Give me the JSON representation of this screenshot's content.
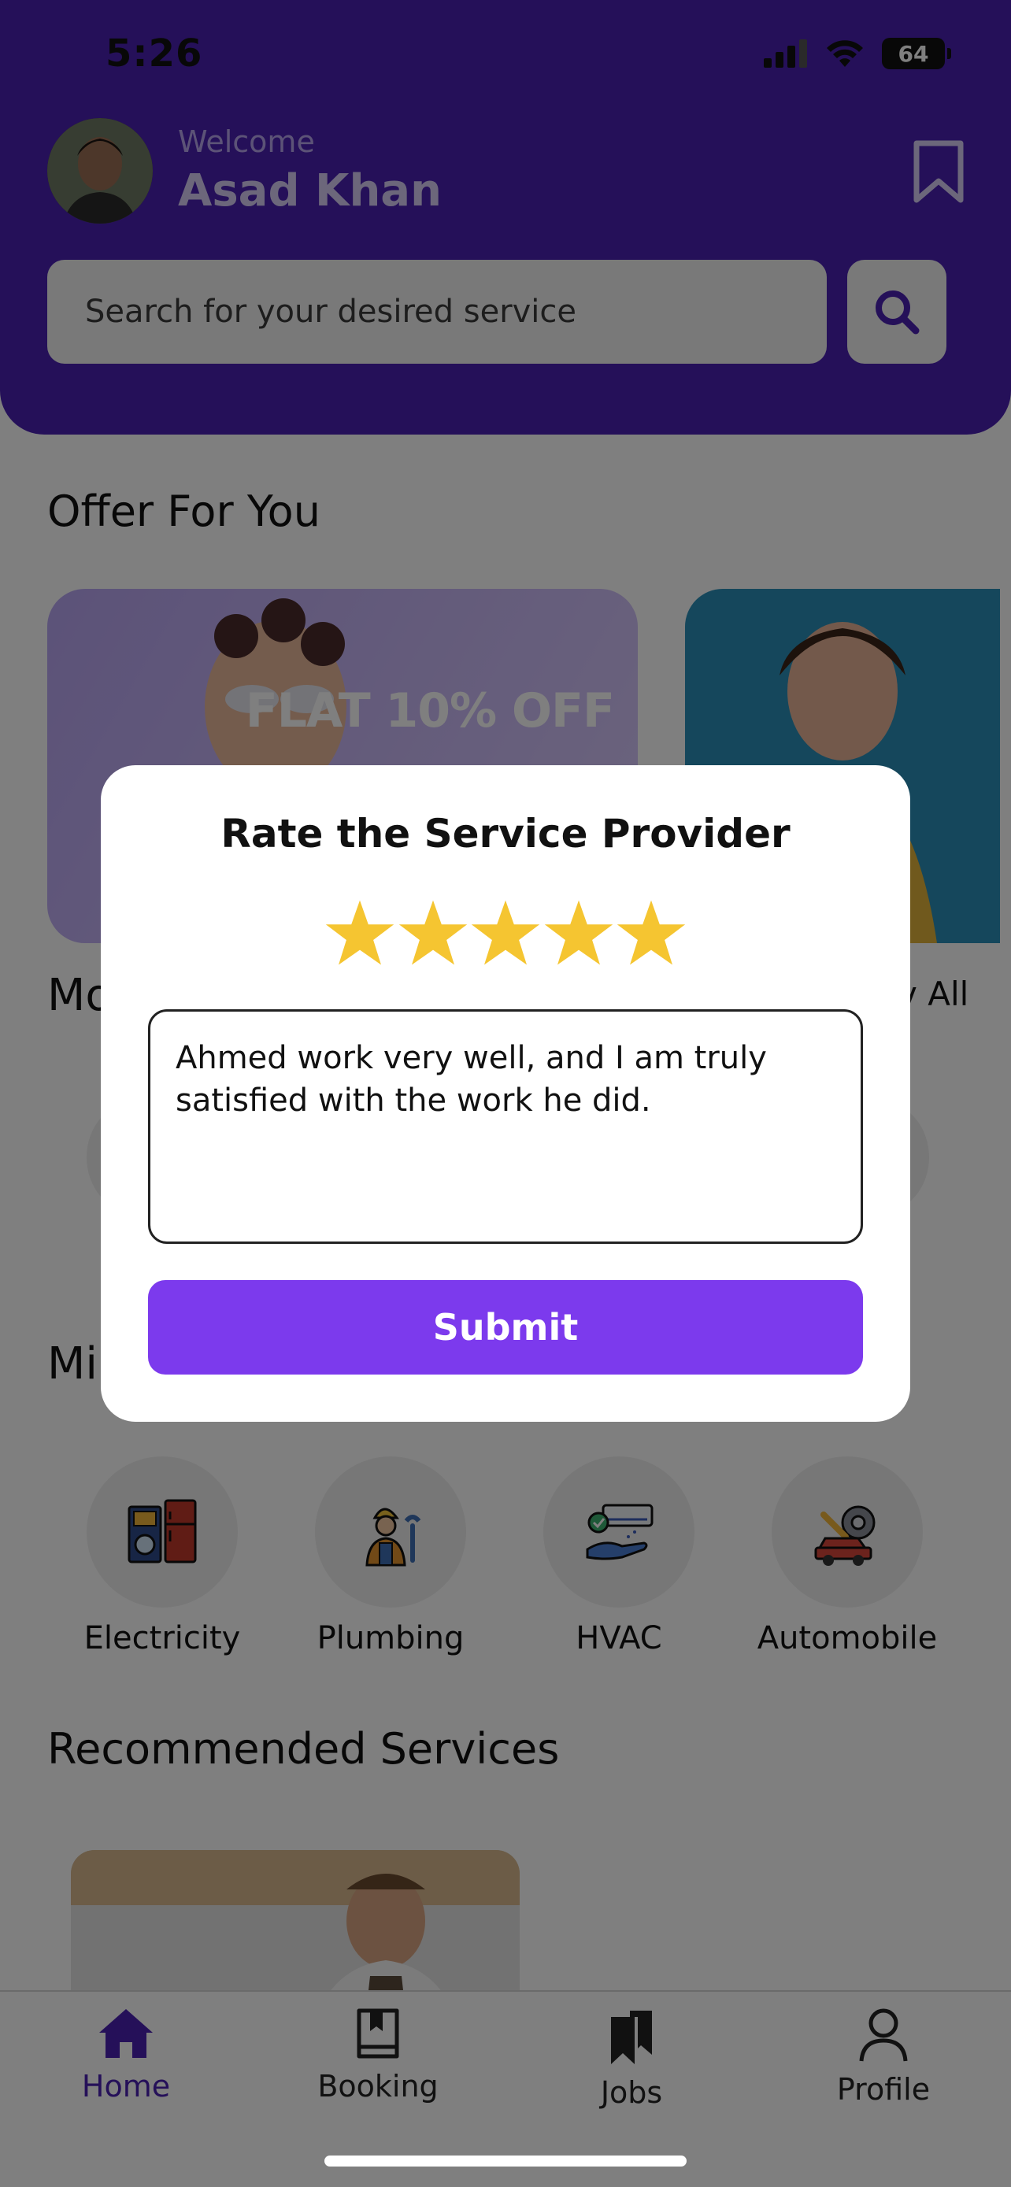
{
  "status_bar": {
    "time": "5:26",
    "battery": "64"
  },
  "header": {
    "welcome": "Welcome",
    "user_name": "Asad Khan",
    "search": {
      "placeholder": "Search for your desired service"
    }
  },
  "offers": {
    "title": "Offer For You",
    "cards": [
      {
        "text": "FLAT 10% OFF"
      }
    ]
  },
  "partial": {
    "most_popular_fragment": "Mo",
    "view_all_fragment": "v All",
    "mini_fragment": "Mi"
  },
  "categories": [
    {
      "label": "Electricity",
      "icon": "appliances-icon"
    },
    {
      "label": "Plumbing",
      "icon": "plumber-icon"
    },
    {
      "label": "HVAC",
      "icon": "hvac-icon"
    },
    {
      "label": "Automobile",
      "icon": "car-repair-icon"
    }
  ],
  "recommended": {
    "title": "Recommended Services"
  },
  "bottom_nav": {
    "items": [
      {
        "label": "Home",
        "active": true
      },
      {
        "label": "Booking"
      },
      {
        "label": "Jobs"
      },
      {
        "label": "Profile"
      }
    ]
  },
  "modal": {
    "title": "Rate the Service Provider",
    "rating": 5,
    "max_rating": 5,
    "review_text": "Ahmed work very well, and I am truly satisfied with the work he did.",
    "submit_label": "Submit"
  },
  "colors": {
    "brand": "#4a21b3",
    "accent": "#7c3aed",
    "star": "#f5c531"
  }
}
